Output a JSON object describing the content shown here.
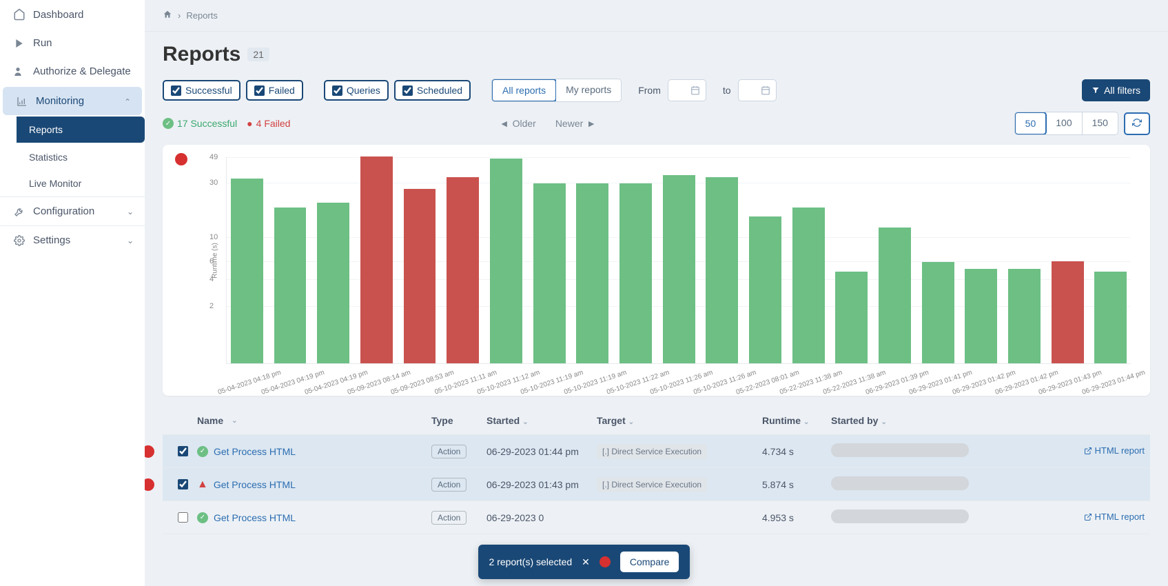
{
  "sidebar": {
    "items": [
      {
        "label": "Dashboard",
        "icon": "home"
      },
      {
        "label": "Run",
        "icon": "play"
      },
      {
        "label": "Authorize & Delegate",
        "icon": "user"
      },
      {
        "label": "Monitoring",
        "icon": "chart",
        "expanded": true,
        "sub": [
          {
            "label": "Reports",
            "current": true
          },
          {
            "label": "Statistics"
          },
          {
            "label": "Live Monitor"
          }
        ]
      },
      {
        "label": "Configuration",
        "icon": "wrench",
        "expanded": false
      },
      {
        "label": "Settings",
        "icon": "gear",
        "expanded": false
      }
    ]
  },
  "breadcrumb": {
    "home": "⌂",
    "sep": "›",
    "current": "Reports"
  },
  "header": {
    "title": "Reports",
    "count": "21"
  },
  "filters": {
    "chips": [
      {
        "label": "Successful",
        "checked": true
      },
      {
        "label": "Failed",
        "checked": true
      },
      {
        "label": "Queries",
        "checked": true
      },
      {
        "label": "Scheduled",
        "checked": true
      }
    ],
    "scope": [
      {
        "label": "All reports",
        "active": true
      },
      {
        "label": "My reports",
        "active": false
      }
    ],
    "from_label": "From",
    "to_label": "to",
    "all_filters": "All filters"
  },
  "status": {
    "success": "17 Successful",
    "failed": "4 Failed",
    "older": "Older",
    "newer": "Newer",
    "page_sizes": [
      "50",
      "100",
      "150"
    ],
    "page_active": "50"
  },
  "chart_data": {
    "type": "bar",
    "ylabel": "Runtime (s)",
    "y_ticks": [
      49,
      30,
      10,
      6,
      4,
      2
    ],
    "y_max": 49,
    "categories": [
      "05-04-2023 04:18 pm",
      "05-04-2023 04:19 pm",
      "05-04-2023 04:19 pm",
      "05-09-2023 08:14 am",
      "05-09-2023 08:53 am",
      "05-10-2023 11:11 am",
      "05-10-2023 11:12 am",
      "05-10-2023 11:19 am",
      "05-10-2023 11:19 am",
      "05-10-2023 11:22 am",
      "05-10-2023 11:26 am",
      "05-10-2023 11:26 am",
      "05-22-2023 08:01 am",
      "05-22-2023 11:38 am",
      "05-22-2023 11:38 am",
      "06-29-2023 01:39 pm",
      "06-29-2023 01:41 pm",
      "06-29-2023 01:42 pm",
      "06-29-2023 01:42 pm",
      "06-29-2023 01:43 pm",
      "06-29-2023 01:44 pm"
    ],
    "series": [
      {
        "value": 32,
        "status": "ok"
      },
      {
        "value": 18,
        "status": "ok"
      },
      {
        "value": 20,
        "status": "ok"
      },
      {
        "value": 49,
        "status": "fail"
      },
      {
        "value": 26,
        "status": "fail"
      },
      {
        "value": 33,
        "status": "fail"
      },
      {
        "value": 47,
        "status": "ok"
      },
      {
        "value": 29,
        "status": "ok"
      },
      {
        "value": 29,
        "status": "ok"
      },
      {
        "value": 29,
        "status": "ok"
      },
      {
        "value": 34,
        "status": "ok"
      },
      {
        "value": 33,
        "status": "ok"
      },
      {
        "value": 15,
        "status": "ok"
      },
      {
        "value": 18,
        "status": "ok"
      },
      {
        "value": 4.7,
        "status": "ok"
      },
      {
        "value": 12,
        "status": "ok"
      },
      {
        "value": 5.8,
        "status": "ok"
      },
      {
        "value": 5.0,
        "status": "ok"
      },
      {
        "value": 5.0,
        "status": "ok"
      },
      {
        "value": 5.9,
        "status": "fail"
      },
      {
        "value": 4.7,
        "status": "ok"
      }
    ]
  },
  "table": {
    "columns": {
      "name": "Name",
      "type": "Type",
      "started": "Started",
      "target": "Target",
      "runtime": "Runtime",
      "started_by": "Started by"
    },
    "rows": [
      {
        "selected": true,
        "marker": true,
        "status": "ok",
        "name": "Get Process HTML",
        "type": "Action",
        "started": "06-29-2023 01:44 pm",
        "target": "[.] Direct Service Execution",
        "runtime": "4.734 s",
        "link": "HTML report"
      },
      {
        "selected": true,
        "marker": true,
        "status": "warn",
        "name": "Get Process HTML",
        "type": "Action",
        "started": "06-29-2023 01:43 pm",
        "target": "[.] Direct Service Execution",
        "runtime": "5.874 s"
      },
      {
        "selected": false,
        "marker": false,
        "status": "ok",
        "name": "Get Process HTML",
        "type": "Action",
        "started": "06-29-2023 0",
        "target": "",
        "runtime": "4.953 s",
        "link": "HTML report"
      }
    ]
  },
  "selection_bar": {
    "text": "2 report(s) selected",
    "compare": "Compare"
  }
}
